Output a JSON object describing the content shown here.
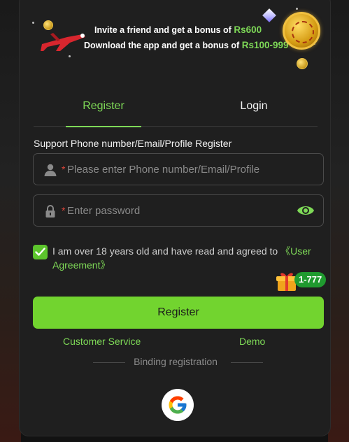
{
  "banner": {
    "line1_text": "Invite a friend and get a bonus of",
    "line1_amount": "Rs600",
    "line2_text": "Download the app and get a bonus of",
    "line2_amount": "Rs100-999"
  },
  "tabs": [
    {
      "label": "Register",
      "active": true
    },
    {
      "label": "Login",
      "active": false
    }
  ],
  "section_title": "Support Phone number/Email/Profile Register",
  "fields": {
    "account_placeholder": "Please enter Phone number/Email/Profile",
    "password_placeholder": "Enter password",
    "required_mark": "*"
  },
  "agreement": {
    "text": "I am over 18 years old and have read and agreed to ",
    "link": "《User Agreement》",
    "checked": true
  },
  "bonus_badge": "1-777",
  "register_button": "Register",
  "links": {
    "customer_service": "Customer Service",
    "demo": "Demo"
  },
  "binding_label": "Binding registration",
  "icons": {
    "user": "user-icon",
    "lock": "lock-icon",
    "eye": "eye-icon",
    "google": "google-icon",
    "gift": "gift-icon",
    "plane": "plane-icon",
    "checkmark": "checkmark-icon"
  },
  "colors": {
    "accent": "#7ed957",
    "button": "#72d42f",
    "required": "#e0463a",
    "badge": "#1f9a2f",
    "panel": "#1f1f1f"
  }
}
